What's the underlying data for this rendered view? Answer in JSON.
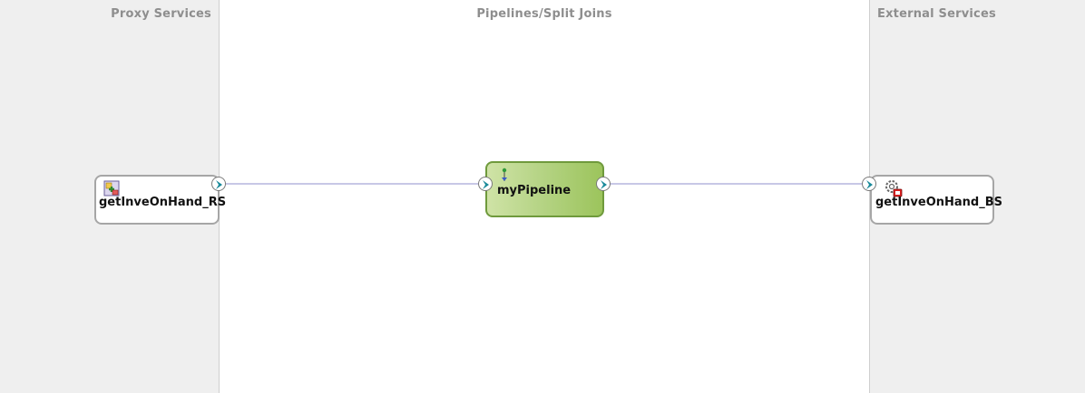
{
  "lanes": {
    "proxy_title": "Proxy Services",
    "pipelines_title": "Pipelines/Split Joins",
    "external_title": "External Services"
  },
  "nodes": {
    "proxy": {
      "label": "getInveOnHand_RS",
      "icon": "proxy-service-icon"
    },
    "pipeline": {
      "label": "myPipeline",
      "icon": "pipeline-icon"
    },
    "business": {
      "label": "getInveOnHand_BS",
      "icon": "business-service-icon"
    }
  },
  "colors": {
    "lane_bg": "#efefef",
    "canvas_bg": "#ffffff",
    "wire": "#c8c8e6",
    "port_arrow": "#1a8a9a",
    "pipeline_fill": "#b6d486",
    "pipeline_border": "#6f9a3c"
  }
}
